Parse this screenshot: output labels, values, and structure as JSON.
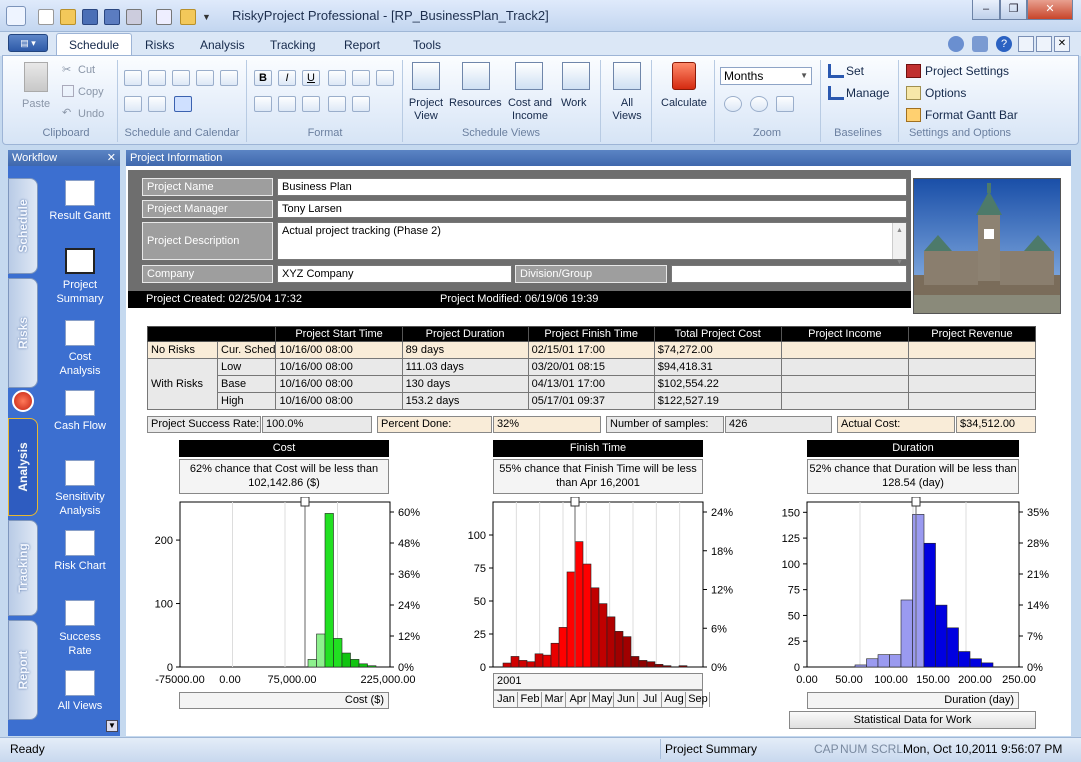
{
  "window": {
    "title": "RiskyProject Professional - [RP_BusinessPlan_Track2]",
    "min": "–",
    "restore": "❐",
    "close": "✕"
  },
  "ribbon": {
    "tabs": [
      "Schedule",
      "Risks",
      "Analysis",
      "Tracking",
      "Report",
      "Tools"
    ],
    "clipboard": {
      "paste": "Paste",
      "cut": "Cut",
      "copy": "Copy",
      "undo": "Undo",
      "label": "Clipboard"
    },
    "schedule_calendar": {
      "label": "Schedule and Calendar"
    },
    "format": {
      "label": "Format",
      "bold": "B",
      "italic": "I",
      "underline": "U"
    },
    "schedule_views": {
      "label": "Schedule Views",
      "project_view": "Project\nView",
      "resources": "Resources",
      "cost_income": "Cost and\nIncome",
      "work": "Work"
    },
    "all_views": "All\nViews",
    "calculate": "Calculate",
    "zoom": {
      "label": "Zoom",
      "select": "Months"
    },
    "baselines": {
      "label": "Baselines",
      "set": "Set",
      "manage": "Manage"
    },
    "settings": {
      "label": "Settings and Options",
      "project_settings": "Project Settings",
      "options": "Options",
      "format_gantt": "Format Gantt Bar"
    }
  },
  "workflow": {
    "title": "Workflow",
    "tabs": [
      "Schedule",
      "Risks",
      "Analysis",
      "Tracking",
      "Report"
    ],
    "items": [
      {
        "label": "Result Gantt"
      },
      {
        "label": "Project\nSummary"
      },
      {
        "label": "Cost\nAnalysis"
      },
      {
        "label": "Cash Flow"
      },
      {
        "label": "Sensitivity\nAnalysis"
      },
      {
        "label": "Risk Chart"
      },
      {
        "label": "Success\nRate"
      },
      {
        "label": "All Views"
      }
    ]
  },
  "project": {
    "header": "Project Information",
    "name_label": "Project Name",
    "name": "Business Plan",
    "manager_label": "Project Manager",
    "manager": "Tony Larsen",
    "desc_label": "Project Description",
    "desc": "Actual project tracking (Phase 2)",
    "company_label": "Company",
    "company": "XYZ Company",
    "division_label": "Division/Group",
    "division": "",
    "created": "Project Created: 02/25/04 17:32",
    "modified": "Project Modified: 06/19/06 19:39"
  },
  "stats": {
    "headers": [
      "Project Start Time",
      "Project Duration",
      "Project Finish Time",
      "Total Project Cost",
      "Project Income",
      "Project Revenue"
    ],
    "no_risks": "No Risks",
    "with_risks": "With Risks",
    "rows": [
      {
        "label": "Cur. Sched",
        "start": "10/16/00 08:00",
        "duration": "89 days",
        "finish": "02/15/01 17:00",
        "cost": "$74,272.00"
      },
      {
        "label": "Low",
        "start": "10/16/00 08:00",
        "duration": "111.03 days",
        "finish": "03/20/01 08:15",
        "cost": "$94,418.31"
      },
      {
        "label": "Base",
        "start": "10/16/00 08:00",
        "duration": "130 days",
        "finish": "04/13/01 17:00",
        "cost": "$102,554.22"
      },
      {
        "label": "High",
        "start": "10/16/00 08:00",
        "duration": "153.2 days",
        "finish": "05/17/01 09:37",
        "cost": "$122,527.19"
      }
    ],
    "success_label": "Project Success Rate:",
    "success": "100.0%",
    "done_label": "Percent Done:",
    "done": "32%",
    "samples_label": "Number of samples:",
    "samples": "426",
    "actual_label": "Actual Cost:",
    "actual": "$34,512.00"
  },
  "chart_data": [
    {
      "type": "bar",
      "title": "Cost",
      "note": "62% chance that Cost will be less than 102,142.86 ($)",
      "xlabel": "Cost ($)",
      "x_ticks": [
        "-75000.00",
        "0.00",
        "75,000.00",
        "225,000.00"
      ],
      "y_ticks": [
        "0",
        "100",
        "200"
      ],
      "y2_ticks": [
        "0%",
        "12%",
        "24%",
        "36%",
        "48%",
        "60%"
      ],
      "ylim": [
        0,
        260
      ],
      "values": [
        12,
        52,
        242,
        45,
        22,
        12,
        5,
        2
      ],
      "colors": [
        "#8df08d",
        "#8df08d",
        "#22e022",
        "#22e022",
        "#11c411",
        "#11c411",
        "#11c411",
        "#11c411"
      ]
    },
    {
      "type": "bar",
      "title": "Finish Time",
      "note": "55% chance that Finish Time will be less than Apr 16,2001",
      "xlabel": "2001",
      "x_ticks": [
        "Jan",
        "Feb",
        "Mar",
        "Apr",
        "May",
        "Jun",
        "Jul",
        "Aug",
        "Sep"
      ],
      "y_ticks": [
        "0",
        "25",
        "50",
        "75",
        "100"
      ],
      "y2_ticks": [
        "0%",
        "6%",
        "12%",
        "18%",
        "24%"
      ],
      "ylim": [
        0,
        125
      ],
      "values": [
        3,
        8,
        5,
        4,
        10,
        9,
        18,
        30,
        72,
        95,
        78,
        60,
        48,
        38,
        27,
        23,
        8,
        5,
        4,
        2,
        1,
        0,
        1
      ],
      "colors": [
        "#d00000",
        "#d00000",
        "#d00000",
        "#d00000",
        "#d00000",
        "#e80000",
        "#e80000",
        "#ff0000",
        "#ff0000",
        "#ff0000",
        "#ff0000",
        "#c00000",
        "#c00000",
        "#b00000",
        "#a00000",
        "#a00000",
        "#900000",
        "#900000",
        "#900000",
        "#900000",
        "#800000",
        "#800000",
        "#800000"
      ]
    },
    {
      "type": "bar",
      "title": "Duration",
      "note": "52% chance that Duration will be less than 128.54 (day)",
      "xlabel": "Duration (day)",
      "x_ticks": [
        "0.00",
        "50.00",
        "100.00",
        "150.00",
        "200.00",
        "250.00"
      ],
      "y_ticks": [
        "0",
        "25",
        "50",
        "75",
        "100",
        "125",
        "150"
      ],
      "y2_ticks": [
        "0%",
        "7%",
        "14%",
        "21%",
        "28%",
        "35%"
      ],
      "ylim": [
        0,
        160
      ],
      "values": [
        2,
        8,
        12,
        12,
        65,
        148,
        120,
        60,
        38,
        15,
        8,
        4
      ],
      "colors": [
        "#9a9af0",
        "#9a9af0",
        "#9a9af0",
        "#9a9af0",
        "#9a9af0",
        "#9a9af0",
        "#0000e0",
        "#0000e0",
        "#0000e0",
        "#0000e0",
        "#0000e0",
        "#0000e0"
      ]
    }
  ],
  "stat_button": "Statistical Data for Work",
  "status": {
    "ready": "Ready",
    "view": "Project Summary",
    "cap": "CAP",
    "num": "NUM",
    "scrl": "SCRL",
    "date": "Mon, Oct 10,2011",
    "time": "9:56:07 PM"
  }
}
